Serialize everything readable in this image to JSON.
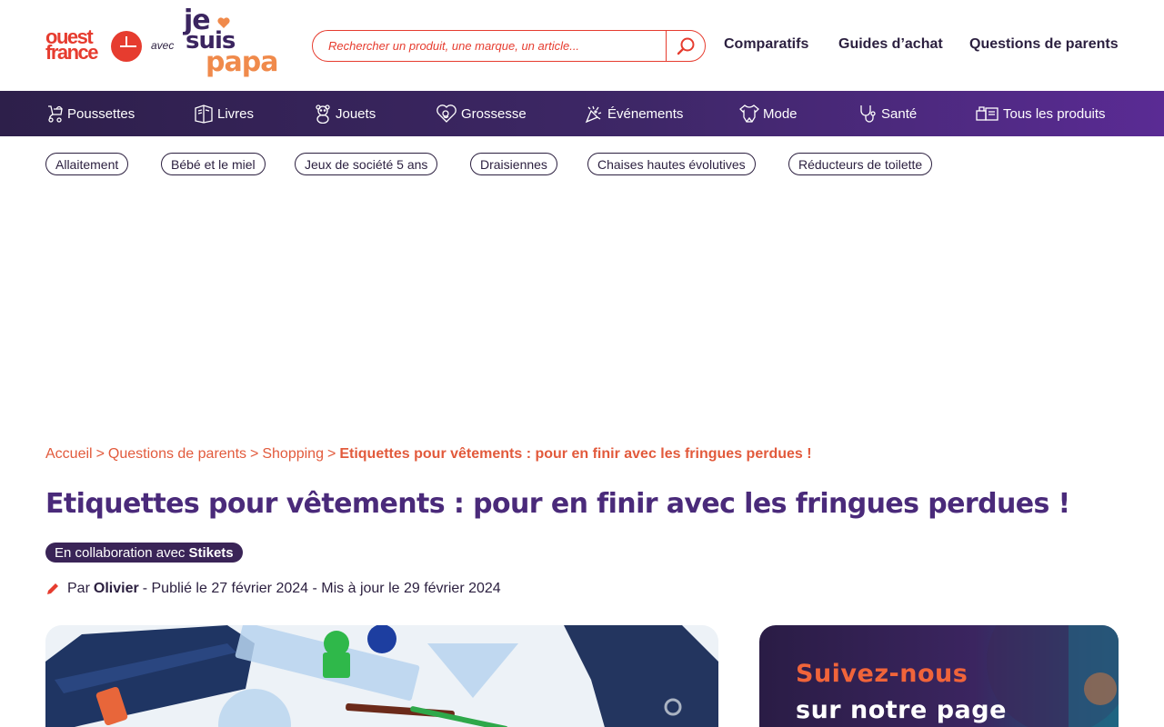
{
  "logo": {
    "ouest_france": "ouest\nfrance",
    "avec": "avec",
    "jesuispapa": {
      "l1": "je",
      "l2": "suis",
      "l3": "papa"
    }
  },
  "search": {
    "placeholder": "Rechercher un produit, une marque, un article...",
    "icon": "search-icon"
  },
  "top_nav": [
    "Comparatifs",
    "Guides d’achat",
    "Questions de parents"
  ],
  "categories": [
    {
      "label": "Poussettes",
      "icon": "stroller-icon"
    },
    {
      "label": "Livres",
      "icon": "book-icon"
    },
    {
      "label": "Jouets",
      "icon": "teddy-bear-icon"
    },
    {
      "label": "Grossesse",
      "icon": "pregnancy-heart-icon"
    },
    {
      "label": "Événements",
      "icon": "confetti-icon"
    },
    {
      "label": "Mode",
      "icon": "bodysuit-icon"
    },
    {
      "label": "Santé",
      "icon": "stethoscope-icon"
    },
    {
      "label": "Tous les produits",
      "icon": "products-icon"
    }
  ],
  "chips": [
    "Allaitement",
    "Bébé et le miel",
    "Jeux de société 5 ans",
    "Draisiennes",
    "Chaises hautes évolutives",
    "Réducteurs de toilette"
  ],
  "breadcrumb": {
    "items": [
      "Accueil",
      "Questions de parents",
      "Shopping"
    ],
    "separator": ">",
    "current": "Etiquettes pour vêtements : pour en finir avec les fringues perdues !"
  },
  "article": {
    "title": "Etiquettes pour vêtements : pour en finir avec les fringues perdues !",
    "collab_prefix": "En collaboration avec",
    "collab_brand": "Stikets",
    "byline_prefix": "Par",
    "author": "Olivier",
    "byline_dates": "- Publié le 27 février 2024 - Mis à jour le 29 février 2024"
  },
  "promo": {
    "line1": "Suivez-nous",
    "line2": "sur notre page"
  },
  "colors": {
    "brand_red": "#e63c2f",
    "purple": "#3e2767",
    "title_purple": "#4a2a7a",
    "breadcrumb_orange": "#e25a3c"
  }
}
